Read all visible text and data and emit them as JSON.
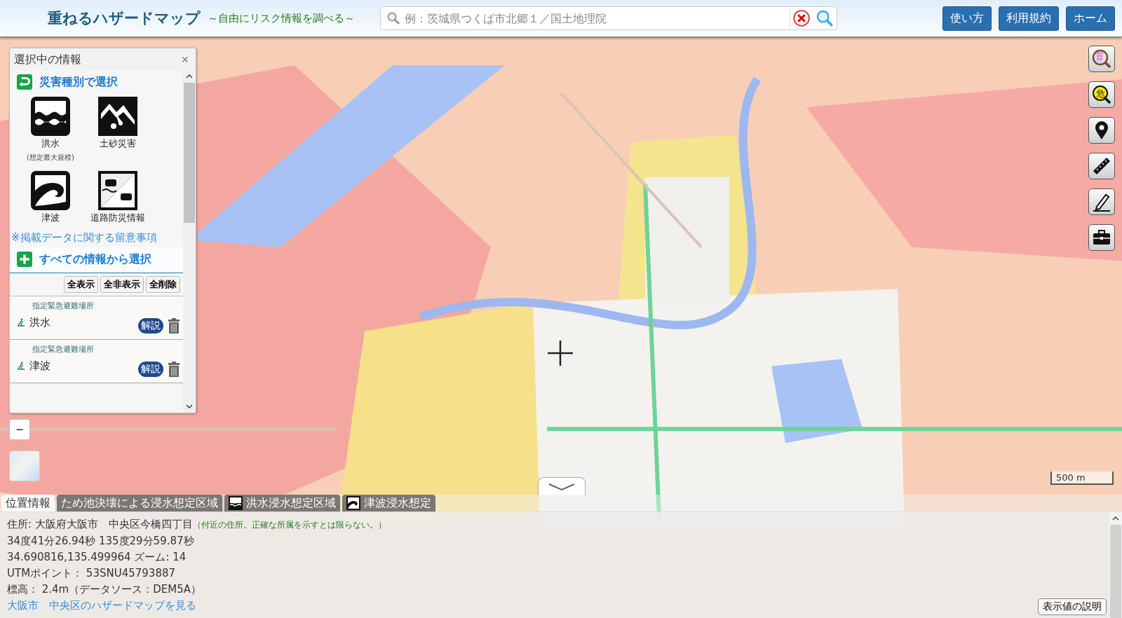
{
  "header": {
    "title": "重ねるハザードマップ",
    "subtitle": "～自由にリスク情報を調べる～",
    "search": {
      "placeholder": "例：茨城県つくば市北郷１／国土地理院"
    },
    "buttons": [
      "使い方",
      "利用規約",
      "ホーム"
    ]
  },
  "panel": {
    "title": "選択中の情報",
    "close": "×",
    "hazard_section": {
      "title": "災害種別で選択",
      "items": [
        {
          "kind": "flood",
          "label": "洪水",
          "note": "(想定最大規模)"
        },
        {
          "kind": "landslide",
          "label": "土砂災害"
        },
        {
          "kind": "tsunami",
          "label": "津波"
        },
        {
          "kind": "road",
          "label": "道路防災情報"
        }
      ],
      "notice": "※掲載データに関する留意事項"
    },
    "all_section": {
      "title": "すべての情報から選択",
      "actions": [
        "全表示",
        "全非表示",
        "全削除"
      ],
      "layers": [
        {
          "category": "指定緊急避難場所",
          "name": "洪水",
          "help": "解説"
        },
        {
          "category": "指定緊急避難場所",
          "name": "津波",
          "help": "解説"
        }
      ]
    }
  },
  "map": {
    "kind": "picture",
    "zoom_out": "−",
    "scale": "500 m",
    "tools": [
      {
        "kind": "map-search"
      },
      {
        "kind": "hazard-search",
        "label": "危"
      },
      {
        "kind": "pin"
      },
      {
        "kind": "ruler"
      },
      {
        "kind": "pencil"
      },
      {
        "kind": "toolbox"
      }
    ]
  },
  "bottom": {
    "tabs": [
      {
        "kind": "plain",
        "label": "位置情報",
        "selected": true
      },
      {
        "kind": "plain",
        "label": "ため池決壊による浸水想定区域",
        "selected": false
      },
      {
        "kind": "flood",
        "label": "洪水浸水想定区域",
        "selected": false
      },
      {
        "kind": "tsunami",
        "label": "津波浸水想定",
        "selected": false
      }
    ],
    "address": "住所: 大阪府大阪市　中央区今橋四丁目",
    "address_note": "（付近の住所。正確な所属を示すとは限らない。）",
    "lines": [
      "34度41分26.94秒 135度29分59.87秒",
      "34.690816,135.499964  ズーム: 14",
      "UTMポイント：  53SNU45793887",
      "標高：  2.4m（データソース：DEM5A）"
    ],
    "link": "大阪市　中央区のハザードマップを見る",
    "explain_button": "表示値の説明"
  }
}
